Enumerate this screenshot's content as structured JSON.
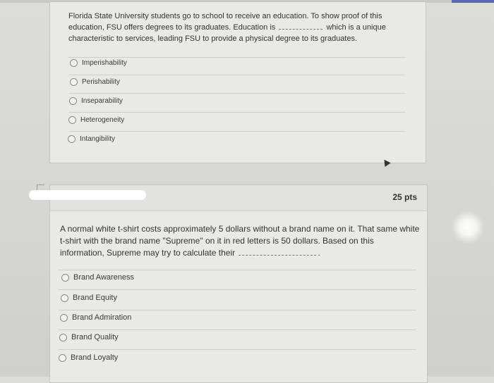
{
  "question1": {
    "text_part1": "Florida State University students go to school to receive an education. To show proof of this education, FSU offers degrees to its graduates. Education is",
    "text_part2": "which is a unique characteristic to services, leading FSU to provide a physical degree to its graduates.",
    "options": [
      "Imperishability",
      "Perishability",
      "Inseparability",
      "Heterogeneity",
      "Intangibility"
    ]
  },
  "question2": {
    "points": "25 pts",
    "text": "A normal white t-shirt costs approximately 5 dollars without a brand name on it. That same white t-shirt with the brand name \"Supreme\" on it in red letters is 50 dollars. Based on this information, Supreme may try to calculate their",
    "text_end": ".",
    "options": [
      "Brand Awareness",
      "Brand Equity",
      "Brand Admiration",
      "Brand Quality",
      "Brand Loyalty"
    ]
  }
}
